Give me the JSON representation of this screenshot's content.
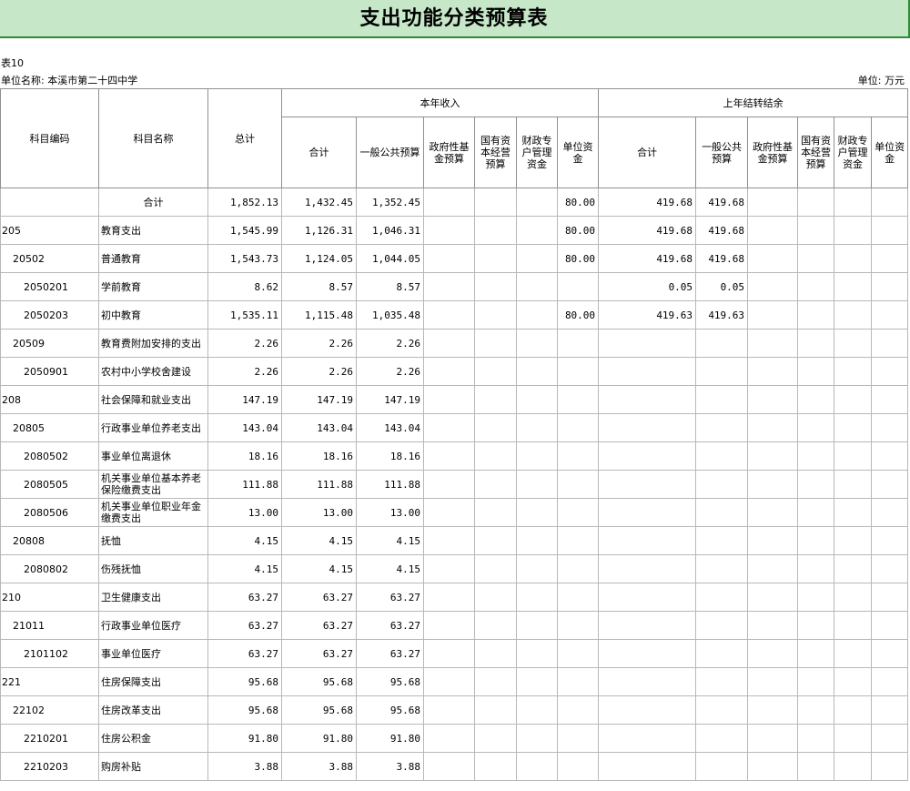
{
  "title": "支出功能分类预算表",
  "table_code": "表10",
  "unit_name": "单位名称: 本溪市第二十四中学",
  "unit_label": "单位: 万元",
  "headers": {
    "subject_code": "科目编码",
    "subject_name": "科目名称",
    "total": "总计",
    "current_year": "本年收入",
    "prior_year": "上年结转结余",
    "sub": [
      "合计",
      "一般公共预算",
      "政府性基金预算",
      "国有资本经营预算",
      "财政专户管理资金",
      "单位资金"
    ]
  },
  "rows": [
    {
      "code": "",
      "indent": 0,
      "name": "合计",
      "center": true,
      "total": "1,852.13",
      "cur": [
        "1,432.45",
        "1,352.45",
        "",
        "",
        "",
        "80.00"
      ],
      "prev": [
        "419.68",
        "419.68",
        "",
        "",
        "",
        ""
      ]
    },
    {
      "code": "205",
      "indent": 0,
      "name": "教育支出",
      "total": "1,545.99",
      "cur": [
        "1,126.31",
        "1,046.31",
        "",
        "",
        "",
        "80.00"
      ],
      "prev": [
        "419.68",
        "419.68",
        "",
        "",
        "",
        ""
      ]
    },
    {
      "code": "20502",
      "indent": 1,
      "name": "普通教育",
      "total": "1,543.73",
      "cur": [
        "1,124.05",
        "1,044.05",
        "",
        "",
        "",
        "80.00"
      ],
      "prev": [
        "419.68",
        "419.68",
        "",
        "",
        "",
        ""
      ]
    },
    {
      "code": "2050201",
      "indent": 2,
      "name": "学前教育",
      "total": "8.62",
      "cur": [
        "8.57",
        "8.57",
        "",
        "",
        "",
        ""
      ],
      "prev": [
        "0.05",
        "0.05",
        "",
        "",
        "",
        ""
      ]
    },
    {
      "code": "2050203",
      "indent": 2,
      "name": "初中教育",
      "total": "1,535.11",
      "cur": [
        "1,115.48",
        "1,035.48",
        "",
        "",
        "",
        "80.00"
      ],
      "prev": [
        "419.63",
        "419.63",
        "",
        "",
        "",
        ""
      ]
    },
    {
      "code": "20509",
      "indent": 1,
      "name": "教育费附加安排的支出",
      "total": "2.26",
      "cur": [
        "2.26",
        "2.26",
        "",
        "",
        "",
        ""
      ],
      "prev": [
        "",
        "",
        "",
        "",
        "",
        ""
      ]
    },
    {
      "code": "2050901",
      "indent": 2,
      "name": "农村中小学校舍建设",
      "total": "2.26",
      "cur": [
        "2.26",
        "2.26",
        "",
        "",
        "",
        ""
      ],
      "prev": [
        "",
        "",
        "",
        "",
        "",
        ""
      ]
    },
    {
      "code": "208",
      "indent": 0,
      "name": "社会保障和就业支出",
      "total": "147.19",
      "cur": [
        "147.19",
        "147.19",
        "",
        "",
        "",
        ""
      ],
      "prev": [
        "",
        "",
        "",
        "",
        "",
        ""
      ]
    },
    {
      "code": "20805",
      "indent": 1,
      "name": "行政事业单位养老支出",
      "total": "143.04",
      "cur": [
        "143.04",
        "143.04",
        "",
        "",
        "",
        ""
      ],
      "prev": [
        "",
        "",
        "",
        "",
        "",
        ""
      ]
    },
    {
      "code": "2080502",
      "indent": 2,
      "name": "事业单位离退休",
      "total": "18.16",
      "cur": [
        "18.16",
        "18.16",
        "",
        "",
        "",
        ""
      ],
      "prev": [
        "",
        "",
        "",
        "",
        "",
        ""
      ]
    },
    {
      "code": "2080505",
      "indent": 2,
      "name": "机关事业单位基本养老保险缴费支出",
      "total": "111.88",
      "cur": [
        "111.88",
        "111.88",
        "",
        "",
        "",
        ""
      ],
      "prev": [
        "",
        "",
        "",
        "",
        "",
        ""
      ]
    },
    {
      "code": "2080506",
      "indent": 2,
      "name": "机关事业单位职业年金缴费支出",
      "total": "13.00",
      "cur": [
        "13.00",
        "13.00",
        "",
        "",
        "",
        ""
      ],
      "prev": [
        "",
        "",
        "",
        "",
        "",
        ""
      ]
    },
    {
      "code": "20808",
      "indent": 1,
      "name": "抚恤",
      "total": "4.15",
      "cur": [
        "4.15",
        "4.15",
        "",
        "",
        "",
        ""
      ],
      "prev": [
        "",
        "",
        "",
        "",
        "",
        ""
      ]
    },
    {
      "code": "2080802",
      "indent": 2,
      "name": "伤残抚恤",
      "total": "4.15",
      "cur": [
        "4.15",
        "4.15",
        "",
        "",
        "",
        ""
      ],
      "prev": [
        "",
        "",
        "",
        "",
        "",
        ""
      ]
    },
    {
      "code": "210",
      "indent": 0,
      "name": "卫生健康支出",
      "total": "63.27",
      "cur": [
        "63.27",
        "63.27",
        "",
        "",
        "",
        ""
      ],
      "prev": [
        "",
        "",
        "",
        "",
        "",
        ""
      ]
    },
    {
      "code": "21011",
      "indent": 1,
      "name": "行政事业单位医疗",
      "total": "63.27",
      "cur": [
        "63.27",
        "63.27",
        "",
        "",
        "",
        ""
      ],
      "prev": [
        "",
        "",
        "",
        "",
        "",
        ""
      ]
    },
    {
      "code": "2101102",
      "indent": 2,
      "name": "事业单位医疗",
      "total": "63.27",
      "cur": [
        "63.27",
        "63.27",
        "",
        "",
        "",
        ""
      ],
      "prev": [
        "",
        "",
        "",
        "",
        "",
        ""
      ]
    },
    {
      "code": "221",
      "indent": 0,
      "name": "住房保障支出",
      "total": "95.68",
      "cur": [
        "95.68",
        "95.68",
        "",
        "",
        "",
        ""
      ],
      "prev": [
        "",
        "",
        "",
        "",
        "",
        ""
      ]
    },
    {
      "code": "22102",
      "indent": 1,
      "name": "住房改革支出",
      "total": "95.68",
      "cur": [
        "95.68",
        "95.68",
        "",
        "",
        "",
        ""
      ],
      "prev": [
        "",
        "",
        "",
        "",
        "",
        ""
      ]
    },
    {
      "code": "2210201",
      "indent": 2,
      "name": "住房公积金",
      "total": "91.80",
      "cur": [
        "91.80",
        "91.80",
        "",
        "",
        "",
        ""
      ],
      "prev": [
        "",
        "",
        "",
        "",
        "",
        ""
      ]
    },
    {
      "code": "2210203",
      "indent": 2,
      "name": "购房补贴",
      "total": "3.88",
      "cur": [
        "3.88",
        "3.88",
        "",
        "",
        "",
        ""
      ],
      "prev": [
        "",
        "",
        "",
        "",
        "",
        ""
      ]
    }
  ]
}
